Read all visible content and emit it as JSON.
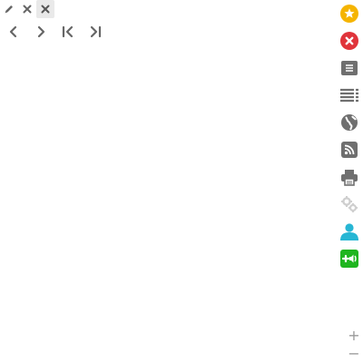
{
  "toolbar": {
    "items": [
      {
        "icon": "pencil-icon",
        "active": false
      },
      {
        "icon": "close-icon",
        "active": false
      },
      {
        "icon": "close-icon",
        "active": true
      }
    ]
  },
  "navigation": {
    "items": [
      {
        "icon": "chevron-left-icon"
      },
      {
        "icon": "chevron-right-icon"
      },
      {
        "icon": "skip-first-icon"
      },
      {
        "icon": "skip-last-icon"
      }
    ]
  },
  "right_rail": {
    "items": [
      {
        "icon": "star-icon",
        "color": "#f5b400"
      },
      {
        "icon": "close-circle-icon",
        "color": "#e0343b"
      },
      {
        "icon": "menu-box-icon",
        "color": "#6f6f6f"
      },
      {
        "icon": "list-icon",
        "color": "#6f6f6f"
      },
      {
        "icon": "globe-icon",
        "color": "#6f6f6f"
      },
      {
        "icon": "rss-icon",
        "color": "#6f6f6f"
      },
      {
        "icon": "printer-icon",
        "color": "#6f6f6f"
      },
      {
        "icon": "gears-icon",
        "color": "#cfcfcf"
      },
      {
        "icon": "user-icon",
        "color": "#27b6d4"
      },
      {
        "icon": "volume-plus-icon",
        "color": "#1fb51f"
      }
    ]
  },
  "zoom": {
    "in_label": "+",
    "out_label": "−"
  }
}
